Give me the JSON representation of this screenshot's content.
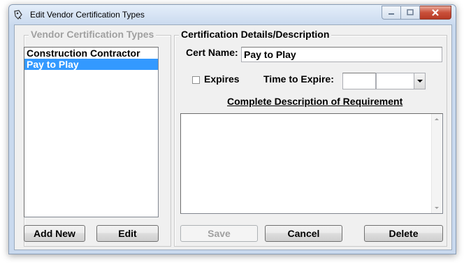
{
  "window": {
    "title": "Edit Vendor Certification Types"
  },
  "left_group": {
    "legend": "Vendor Certification Types",
    "items": [
      {
        "label": "Construction Contractor",
        "selected": false
      },
      {
        "label": "Pay to Play",
        "selected": true
      }
    ],
    "add_new_label": "Add New",
    "edit_label": "Edit"
  },
  "right_group": {
    "legend": "Certification Details/Description",
    "cert_name_label": "Cert Name:",
    "cert_name_value": "Pay to Play",
    "expires_label": "Expires",
    "expires_checked": false,
    "time_to_expire_label": "Time to Expire:",
    "time_value": "",
    "time_unit_value": "",
    "description_heading": "Complete Description of Requirement",
    "description_value": "",
    "save_label": "Save",
    "cancel_label": "Cancel",
    "delete_label": "Delete"
  },
  "colors": {
    "selection": "#3399ff",
    "close_button": "#c9503a",
    "client_background": "#f0f0f0"
  },
  "icons": [
    "app-icon",
    "minimize-icon",
    "maximize-icon",
    "close-icon",
    "chevron-down-icon",
    "scroll-up-icon",
    "scroll-down-icon"
  ]
}
